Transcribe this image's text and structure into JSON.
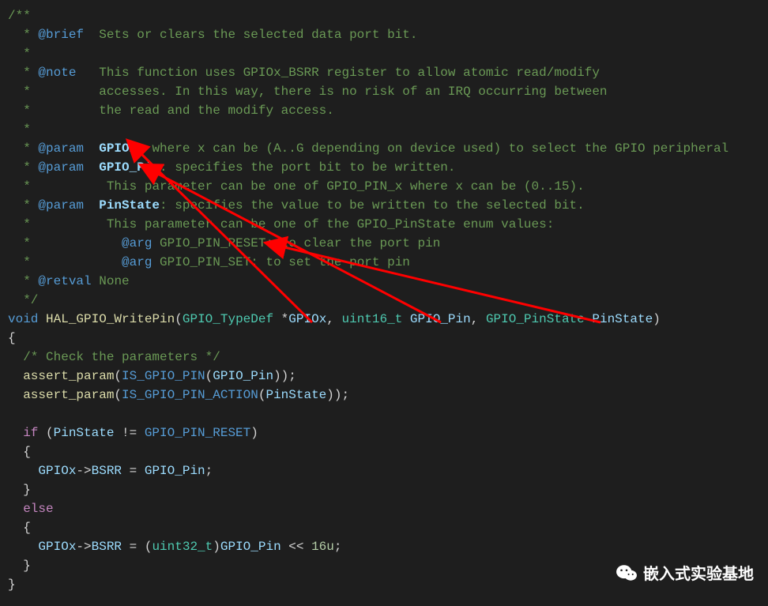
{
  "code": {
    "doc_open": "/**",
    "brief_tag": "@brief",
    "brief_txt": "Sets or clears the selected data port bit.",
    "note_tag": "@note",
    "note_l1": "This function uses GPIOx_BSRR register to allow atomic read/modify",
    "note_l2": "accesses. In this way, there is no risk of an IRQ occurring between",
    "note_l3": "the read and the modify access.",
    "param_tag": "@param",
    "p1_name": "GPIOx",
    "p1_desc": ": where x can be (A..G depending on device used) to select the GPIO peripheral",
    "p2_name": "GPIO_Pin",
    "p2_desc": ": specifies the port bit to be written.",
    "p2_desc2": "This parameter can be one of GPIO_PIN_x where x can be (0..15).",
    "p3_name": "PinState",
    "p3_desc": ": specifies the value to be written to the selected bit.",
    "p3_desc2": "This parameter can be one of the GPIO_PinState enum values:",
    "arg_tag": "@arg",
    "arg1": "GPIO_PIN_RESET: to clear the port pin",
    "arg2": "GPIO_PIN_SET: to set the port pin",
    "ret_tag": "@retval",
    "ret_txt": "None",
    "doc_close": "*/",
    "kw_void": "void",
    "fn_name": "HAL_GPIO_WritePin",
    "ty1": "GPIO_TypeDef",
    "arg1id": "GPIOx",
    "ty2": "uint16_t",
    "arg2id": "GPIO_Pin",
    "ty3": "GPIO_PinState",
    "arg3id": "PinState",
    "body_cmt": "/* Check the parameters */",
    "assert_fn": "assert_param",
    "m_ispin": "IS_GPIO_PIN",
    "m_isact": "IS_GPIO_PIN_ACTION",
    "cf_if": "if",
    "reset_c": "GPIO_PIN_RESET",
    "bsrr": "BSRR",
    "cf_else": "else",
    "ty_u32": "uint32_t",
    "shift": "16u"
  },
  "watermark": {
    "text": "嵌入式实验基地"
  }
}
